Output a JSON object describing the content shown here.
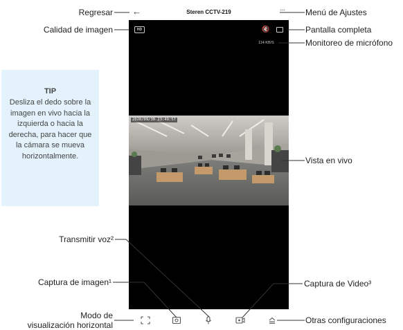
{
  "app": {
    "title": "Steren CCTV-219",
    "hd_label": "HD",
    "bitrate": "114 KB/S",
    "timestamp": "2020/09/30 23:49:57"
  },
  "tip": {
    "title": "TIP",
    "body": "Desliza el dedo sobre la imagen en vivo hacia la izquierda o hacia la derecha, para hacer que la cámara se mueva horizontalmente."
  },
  "annotations": {
    "back": "Regresar",
    "quality": "Calidad de imagen",
    "talk": "Transmitir voz²",
    "snapshot": "Captura de imagen¹",
    "landscape_line1": "Modo de",
    "landscape_line2": "visualización horizontal",
    "settings_menu": "Menú de Ajustes",
    "fullscreen": "Pantalla completa",
    "mic_monitor": "Monitoreo de micrófono",
    "live_view": "Vista en vivo",
    "video_capture": "Captura de Video³",
    "other_settings": "Otras configuraciones"
  },
  "icons": {
    "back": "arrow-left-icon",
    "more": "more-dots-icon",
    "hd": "hd-badge-icon",
    "mute": "speaker-mute-icon",
    "fullscreen": "fullscreen-icon",
    "landscape": "expand-corners-icon",
    "snapshot": "camera-icon",
    "mic": "microphone-icon",
    "record": "video-record-icon",
    "other": "eject-menu-icon"
  },
  "colors": {
    "tip_background": "#e3f2fb",
    "video_background": "#000000",
    "annotation_line": "#333333"
  }
}
